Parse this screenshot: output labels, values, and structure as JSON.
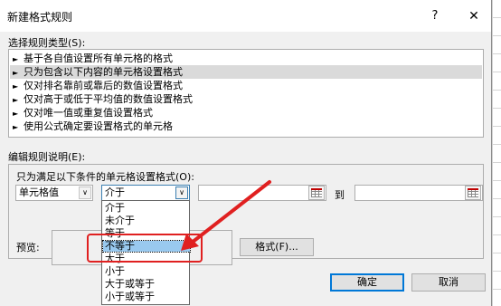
{
  "window": {
    "title": "新建格式规则",
    "help_glyph": "?",
    "close_glyph": "✕"
  },
  "rule_type": {
    "label": "选择规则类型(S):",
    "items": [
      {
        "label": "基于各自值设置所有单元格的格式",
        "selected": false
      },
      {
        "label": "只为包含以下内容的单元格设置格式",
        "selected": true
      },
      {
        "label": "仅对排名靠前或靠后的数值设置格式",
        "selected": false
      },
      {
        "label": "仅对高于或低于平均值的数值设置格式",
        "selected": false
      },
      {
        "label": "仅对唯一值或重复值设置格式",
        "selected": false
      },
      {
        "label": "使用公式确定要设置格式的单元格",
        "selected": false
      }
    ]
  },
  "rule_desc": {
    "label": "编辑规则说明(E):",
    "condition_label": "只为满足以下条件的单元格设置格式(O):",
    "cell_combo": "单元格值",
    "operator_combo": "介于",
    "to_label": "到",
    "preview_label": "预览:",
    "format_button": "格式(F)..."
  },
  "operator_dropdown": {
    "options": [
      "介于",
      "未介于",
      "等于",
      "不等于",
      "大于",
      "小于",
      "大于或等于",
      "小于或等于"
    ],
    "selected_index": 3
  },
  "buttons": {
    "ok": "确定",
    "cancel": "取消"
  },
  "annotation": {
    "highlight_color": "#e02020",
    "arrow_color": "#e02020"
  },
  "icons": {
    "tri": "►",
    "chevron": "∨"
  }
}
